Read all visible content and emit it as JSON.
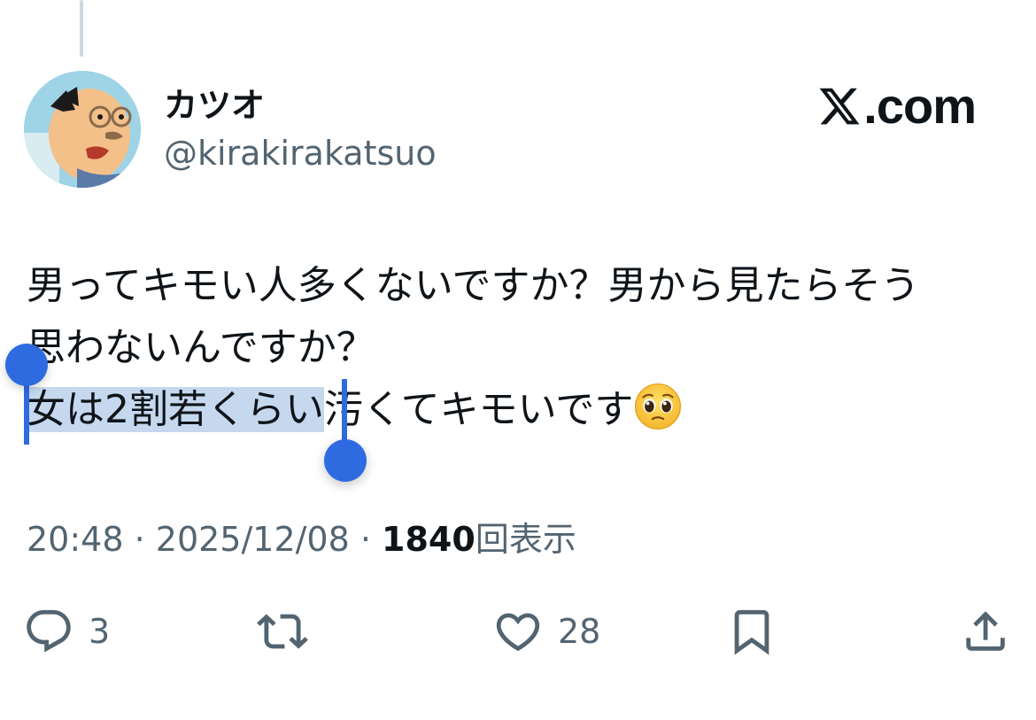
{
  "author": {
    "display_name": "カツオ",
    "handle": "@kirakirakatsuo"
  },
  "brand": {
    "label": ".com",
    "icon": "x-logo-icon"
  },
  "tweet": {
    "line1": "男ってキモい人多くないですか？男から見たらそう",
    "line2": "思わないんですか？",
    "line3_selected": "女は2割若くらい",
    "line3_rest": "汚くてキモいです",
    "emoji": "pleading-face-emoji"
  },
  "meta": {
    "time": "20:48",
    "separator": " · ",
    "date": "2025/12/08",
    "views_count": "1840",
    "views_label": "回表示"
  },
  "actions": {
    "reply_count": "3",
    "like_count": "28"
  },
  "colors": {
    "selection": "#c5d8ee",
    "selection_handle": "#2f6be0",
    "secondary_text": "#536471",
    "primary_text": "#0f1419"
  }
}
